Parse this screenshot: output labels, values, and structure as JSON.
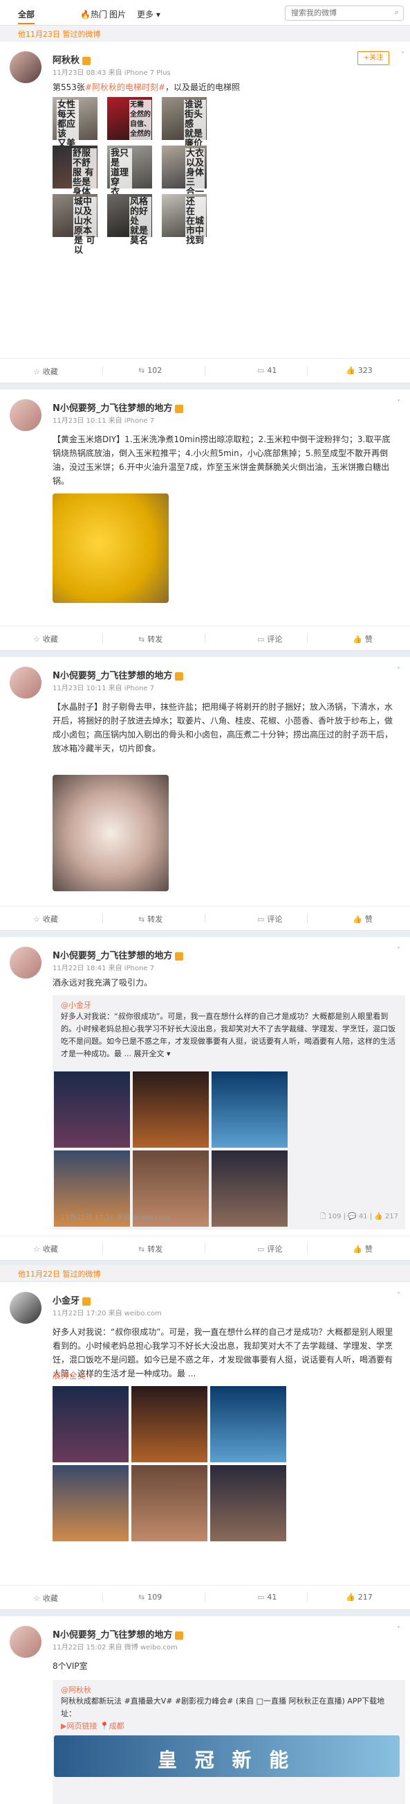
{
  "topbar": {
    "tabs": [
      {
        "label": "全部",
        "active": true
      },
      {
        "label": "🔥热门",
        "active": false
      },
      {
        "label": "图片",
        "active": false
      },
      {
        "label": "更多 ▾",
        "active": false
      }
    ],
    "search_placeholder": "搜索我的微博"
  },
  "dividers": {
    "d1": "他11月23日 暂过的微博",
    "d2": "他11月22日 暂过的微博"
  },
  "posts": [
    {
      "user": "阿秋秋",
      "meta": "11月23日 08:43 来自 iPhone 7 Plus",
      "follow": "+关注",
      "text_prefix": "第553张",
      "text_link": "#阿秋秋的电梯时刻#",
      "text_suffix": "，以及最近的电梯照",
      "thumbs": [
        {
          "t": "女性 每天 都应该 又美 又利落"
        },
        {
          "t": "无需 全然的 自信、 全然的"
        },
        {
          "t": "谁说 街头感 就是 廉价的 代名词"
        },
        {
          "t": "舒服 不舒服 有些是 身体上的"
        },
        {
          "t": "我只是 道理 穿 衣 这事儿 没有"
        },
        {
          "t": "大衣 以及 身体 三 合一"
        },
        {
          "t": "城中 以及 山水 原本是 可以"
        },
        {
          "t": "风格 的好处 就是 莫名"
        },
        {
          "t": "还 在 在城市中 找到"
        }
      ],
      "actions": {
        "fav": "收藏",
        "repost": "102",
        "comment": "41",
        "like": "323"
      }
    },
    {
      "user": "N小倪要努_力飞往梦想的地方",
      "meta": "11月23日 10:11 来自 iPhone 7",
      "text": "【黄金玉米烙DIY】1.玉米洗净煮10min捞出晾凉取粒；2.玉米粒中倒干淀粉拌匀；3.取平底锅烧热锅底放油，倒入玉米粒推平；4.小火煎5min，小心底部焦掉；5.煎至成型不散开再倒油，没过玉米饼；6.开中火油升温至7成，炸至玉米饼金黄酥脆关火倒出油，玉米饼撒白糖出锅。",
      "actions": {
        "fav": "收藏",
        "repost": "转发",
        "comment": "评论",
        "like": "赞"
      }
    },
    {
      "user": "N小倪要努_力飞往梦想的地方",
      "meta": "11月23日 10:11 来自 iPhone 7",
      "text": "【水晶肘子】肘子剔骨去甲，抹些许盐；把用绳子将剃开的肘子捆好；放入汤锅，下清水，水开后，将捆好的肘子放进去焯水；取姜片、八角、桂皮、花椒、小茴香、香叶放于纱布上，做成小卤包；高压锅内加入剔出的骨头和小卤包，高压煮二十分钟；捞出高压过的肘子沥干后，放冰箱冷藏半天，切片即食。",
      "actions": {
        "fav": "收藏",
        "repost": "转发",
        "comment": "评论",
        "like": "赞"
      }
    },
    {
      "user": "N小倪要努_力飞往梦想的地方",
      "meta": "11月22日 18:41 来自 iPhone 7",
      "text": "酒永远对我充满了吸引力。",
      "repost": {
        "ruser": "@小金牙",
        "text": "好多人对我说：“叔你很成功”。可是，我一直在想什么样的自己才是成功？大概都是别人眼里看到的。小时候老妈总担心我学习不好长大没出息，我却笑对大不了去学裁缝、学理发、学烹饪，混口饭吃不是问题。如今已是不惑之年，才发现做事要有人挺，说话要有人听，喝酒要有人陪，这样的生活才是一种成功。最 ... 展开全文 ▾",
        "meta": "11月22日 17:20 来自 weibo.com",
        "stats": "🗋 109 | 💬 41 | 👍 217"
      },
      "actions": {
        "fav": "收藏",
        "repost": "转发",
        "comment": "评论",
        "like": "赞"
      }
    },
    {
      "user": "小金牙",
      "meta": "11月22日 17:20 来自 weibo.com",
      "text": "好多人对我说：“叔你很成功”。可是，我一直在想什么样的自己才是成功？大概都是别人眼里看到的。小时候老妈总担心我学习不好长大没出息，我却笑对大不了去学裁缝、学理发、学烹饪，混口饭吃不是问题。如今已是不惑之年，才发现做事要有人挺，说话要有人听，喝酒要有人陪，这样的生活才是一种成功。最 ...",
      "expand": "展开全文 ▾",
      "actions": {
        "fav": "收藏",
        "repost": "109",
        "comment": "41",
        "like": "217"
      }
    },
    {
      "user": "N小倪要努_力飞往梦想的地方",
      "meta": "11月22日 15:02 来自 微博 weibo.com",
      "text": "8个VIP室",
      "repost": {
        "ruser": "@阿秋秋",
        "text": "阿秋秋成都新玩法 #直播最大V# #剧影视力峰会# (来自 □一直播 阿秋秋正在直播) APP下载地址：",
        "link": "▶网页链接  📍成都",
        "banner": "皇 冠 新 能"
      }
    }
  ]
}
